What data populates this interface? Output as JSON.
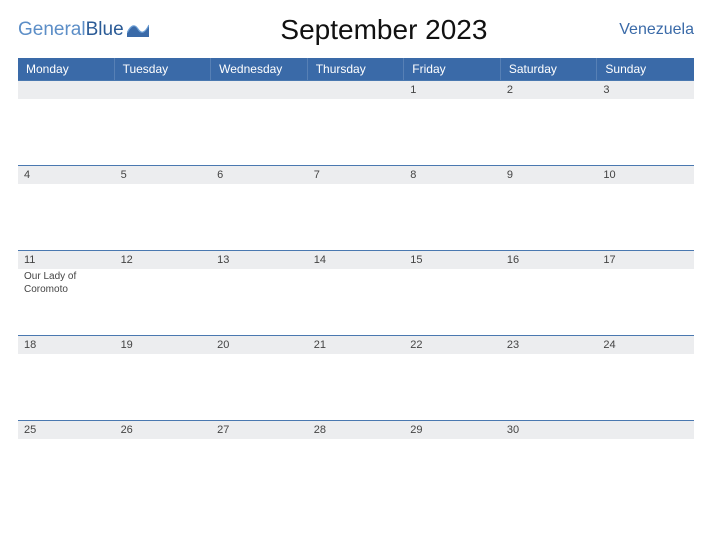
{
  "brand": {
    "part1": "General",
    "part2": "Blue"
  },
  "title": "September 2023",
  "country": "Venezuela",
  "dow": [
    "Monday",
    "Tuesday",
    "Wednesday",
    "Thursday",
    "Friday",
    "Saturday",
    "Sunday"
  ],
  "weeks": [
    [
      {
        "n": "",
        "ev": ""
      },
      {
        "n": "",
        "ev": ""
      },
      {
        "n": "",
        "ev": ""
      },
      {
        "n": "",
        "ev": ""
      },
      {
        "n": "1",
        "ev": ""
      },
      {
        "n": "2",
        "ev": ""
      },
      {
        "n": "3",
        "ev": ""
      }
    ],
    [
      {
        "n": "4",
        "ev": ""
      },
      {
        "n": "5",
        "ev": ""
      },
      {
        "n": "6",
        "ev": ""
      },
      {
        "n": "7",
        "ev": ""
      },
      {
        "n": "8",
        "ev": ""
      },
      {
        "n": "9",
        "ev": ""
      },
      {
        "n": "10",
        "ev": ""
      }
    ],
    [
      {
        "n": "11",
        "ev": "Our Lady of Coromoto"
      },
      {
        "n": "12",
        "ev": ""
      },
      {
        "n": "13",
        "ev": ""
      },
      {
        "n": "14",
        "ev": ""
      },
      {
        "n": "15",
        "ev": ""
      },
      {
        "n": "16",
        "ev": ""
      },
      {
        "n": "17",
        "ev": ""
      }
    ],
    [
      {
        "n": "18",
        "ev": ""
      },
      {
        "n": "19",
        "ev": ""
      },
      {
        "n": "20",
        "ev": ""
      },
      {
        "n": "21",
        "ev": ""
      },
      {
        "n": "22",
        "ev": ""
      },
      {
        "n": "23",
        "ev": ""
      },
      {
        "n": "24",
        "ev": ""
      }
    ],
    [
      {
        "n": "25",
        "ev": ""
      },
      {
        "n": "26",
        "ev": ""
      },
      {
        "n": "27",
        "ev": ""
      },
      {
        "n": "28",
        "ev": ""
      },
      {
        "n": "29",
        "ev": ""
      },
      {
        "n": "30",
        "ev": ""
      },
      {
        "n": "",
        "ev": ""
      }
    ]
  ]
}
